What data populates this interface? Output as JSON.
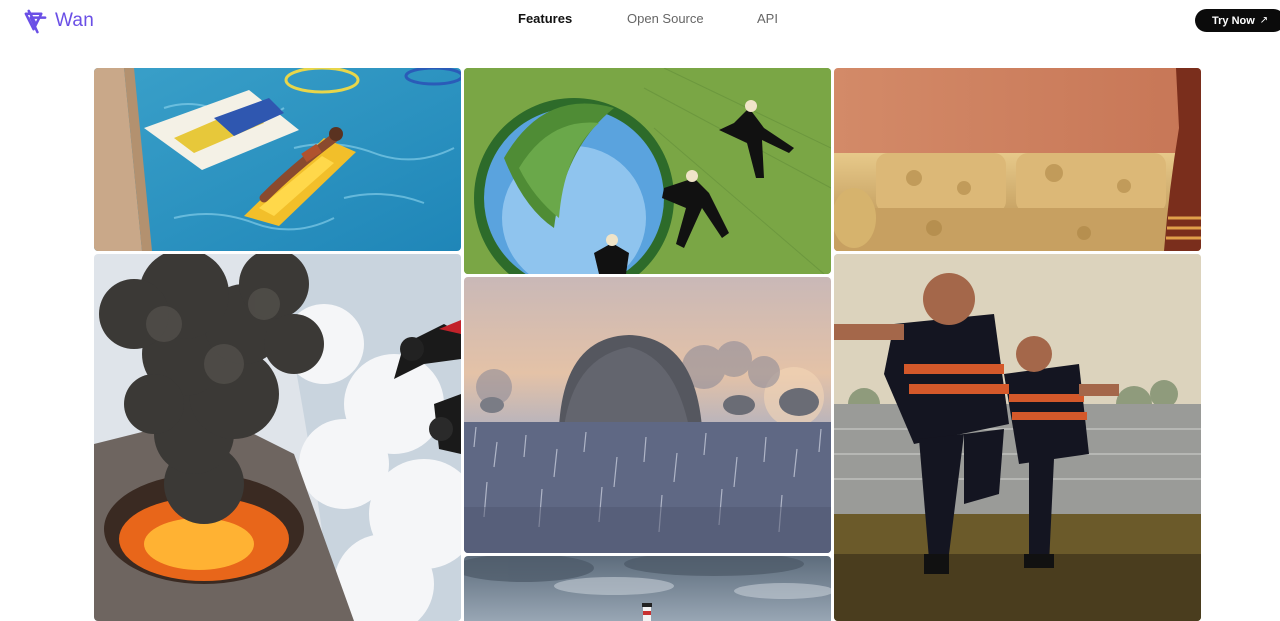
{
  "brand": {
    "name": "Wan",
    "logo_icon": "wan-star-logo",
    "accent": "#6a4fe6"
  },
  "nav": {
    "items": [
      {
        "label": "Features",
        "active": true
      },
      {
        "label": "Open Source",
        "active": false
      },
      {
        "label": "API",
        "active": false
      }
    ]
  },
  "cta": {
    "label": "Try Now",
    "icon": "arrow-up-right-icon",
    "background": "#0b0b0b"
  },
  "gallery": {
    "tiles": [
      {
        "subject": "pool-float"
      },
      {
        "subject": "fisheye-jump"
      },
      {
        "subject": "golden-sofa"
      },
      {
        "subject": "volcano-skydivers"
      },
      {
        "subject": "haystack-dawn"
      },
      {
        "subject": "rugby-players"
      },
      {
        "subject": "lighthouse-storm"
      }
    ]
  }
}
